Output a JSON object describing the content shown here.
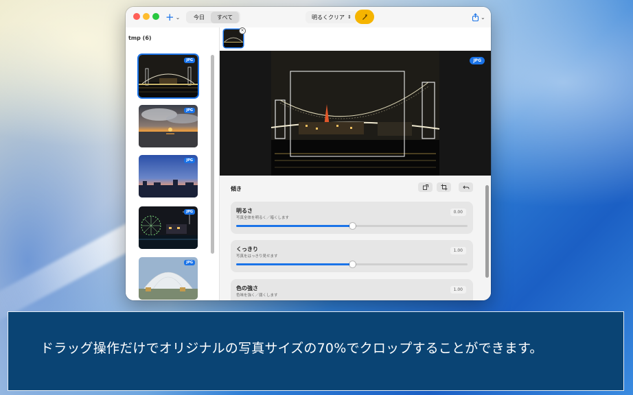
{
  "toolbar": {
    "add_icon": "plus-icon",
    "segments": [
      "今日",
      "すべて"
    ],
    "selected_segment": "すべて",
    "preset_label": "明るくクリア",
    "wand_color": "#f5b400",
    "share_icon": "share-icon"
  },
  "sidebar": {
    "folder_title": "tmp (6)",
    "thumbnails": [
      {
        "badge": "JPG",
        "selected": true,
        "scene": "night-bridge"
      },
      {
        "badge": "JPG",
        "selected": false,
        "scene": "sunset-sea"
      },
      {
        "badge": "JPG",
        "selected": false,
        "scene": "dusk-city"
      },
      {
        "badge": "JPG",
        "selected": false,
        "scene": "ferris-wheel-night"
      },
      {
        "badge": "JPG",
        "selected": false,
        "scene": "dome-building"
      }
    ]
  },
  "preview": {
    "format_badge": "JPG"
  },
  "adjust": {
    "title": "傾き",
    "sliders": [
      {
        "label": "明るさ",
        "desc": "写真全体を明るく／暗くします",
        "value": "0.00",
        "position": 0.5
      },
      {
        "label": "くっきり",
        "desc": "写真をはっきり見せます",
        "value": "1.00",
        "position": 0.5
      },
      {
        "label": "色の強さ",
        "desc": "色味を強く／弱くします",
        "value": "1.00",
        "position": 0.5
      }
    ]
  },
  "caption": {
    "text": "ドラッグ操作だけでオリジナルの写真サイズの70%でクロップすることができます。"
  },
  "colors": {
    "accent": "#1a73e8",
    "caption_bg": "#0a4474"
  }
}
